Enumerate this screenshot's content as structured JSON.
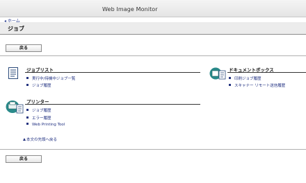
{
  "app": {
    "title": "Web Image Monitor"
  },
  "nav": {
    "home": "◂ ホーム"
  },
  "page": {
    "title": "ジョブ"
  },
  "buttons": {
    "back_top": "戻る",
    "back_bottom": "戻る"
  },
  "sections": {
    "job_list": {
      "heading": "ジョブリスト",
      "items": [
        "実行中/待機中ジョブ一覧",
        "ジョブ履歴"
      ]
    },
    "printer": {
      "heading": "プリンター",
      "items": [
        "ジョブ履歴",
        "エラー履歴",
        "Web Printing Tool"
      ]
    },
    "document_box": {
      "heading": "ドキュメントボックス",
      "items": [
        "印刷ジョブ履歴",
        "スキャナー リモート送信履歴"
      ]
    }
  },
  "footer": {
    "back_to_top": "本文の先頭へ戻る"
  },
  "icons": {
    "job_list": "document-list-icon",
    "printer": "printer-icon",
    "document_box": "document-box-icon"
  },
  "colors": {
    "link": "#1f2f80",
    "bullet": "#24337f",
    "icon_teal": "#2a8a8a"
  }
}
